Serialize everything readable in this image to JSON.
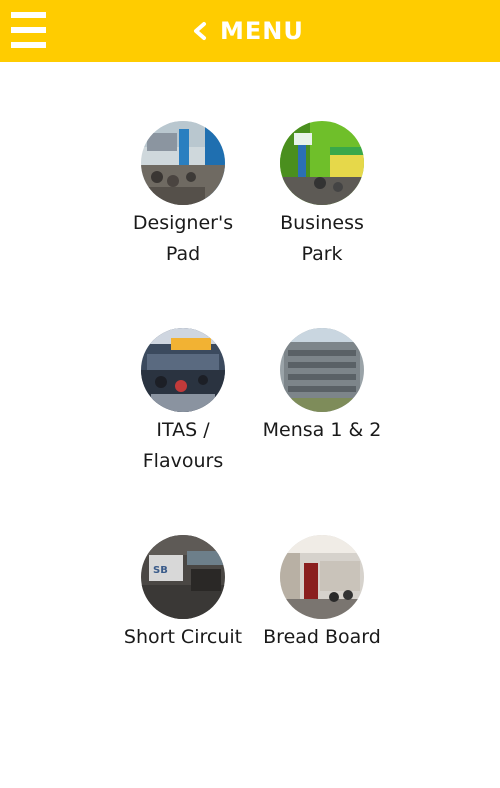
{
  "header": {
    "title": "MENU",
    "menu_icon": "hamburger-icon",
    "back_icon": "chevron-left-icon",
    "background_color": "#FFCC00"
  },
  "canteens": [
    {
      "label_line1": "Designer's",
      "label_line2": "Pad"
    },
    {
      "label_line1": "Business",
      "label_line2": "Park"
    },
    {
      "label_line1": "ITAS /",
      "label_line2": "Flavours"
    },
    {
      "label_line1": "Mensa 1 & 2",
      "label_line2": ""
    },
    {
      "label_line1": "Short Circuit",
      "label_line2": ""
    },
    {
      "label_line1": "Bread Board",
      "label_line2": ""
    }
  ]
}
